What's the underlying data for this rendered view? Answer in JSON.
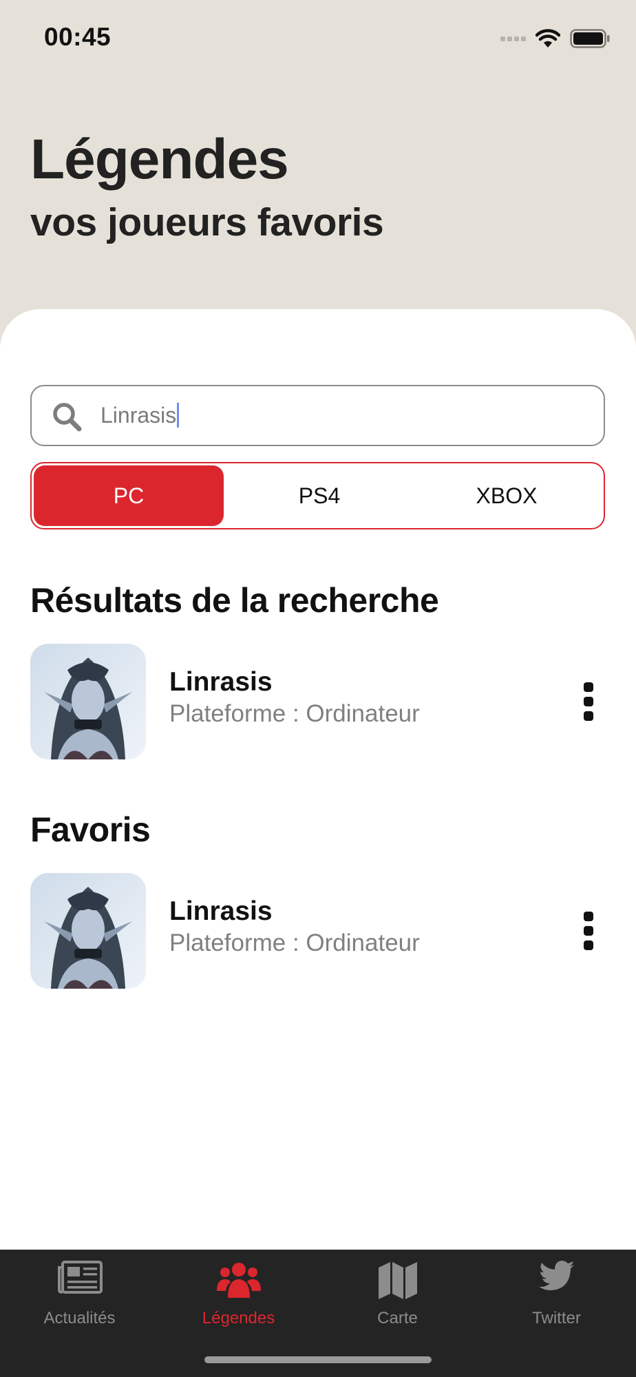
{
  "status_bar": {
    "time": "00:45"
  },
  "header": {
    "title": "Légendes",
    "subtitle": "vos joueurs favoris"
  },
  "search": {
    "value": "Linrasis"
  },
  "platforms": {
    "options": [
      "PC",
      "PS4",
      "XBOX"
    ],
    "selected": "PC"
  },
  "results": {
    "title": "Résultats de la recherche",
    "items": [
      {
        "name": "Linrasis",
        "platform": "Plateforme : Ordinateur"
      }
    ]
  },
  "favorites": {
    "title": "Favoris",
    "items": [
      {
        "name": "Linrasis",
        "platform": "Plateforme : Ordinateur"
      }
    ]
  },
  "tab_bar": {
    "tabs": [
      {
        "label": "Actualités",
        "icon": "newspaper-icon"
      },
      {
        "label": "Légendes",
        "icon": "users-icon"
      },
      {
        "label": "Carte",
        "icon": "map-icon"
      },
      {
        "label": "Twitter",
        "icon": "twitter-icon"
      }
    ],
    "active": "Légendes"
  },
  "colors": {
    "accent": "#dc262e",
    "header_bg": "#e6e1d8",
    "tab_bar_bg": "#242424"
  }
}
